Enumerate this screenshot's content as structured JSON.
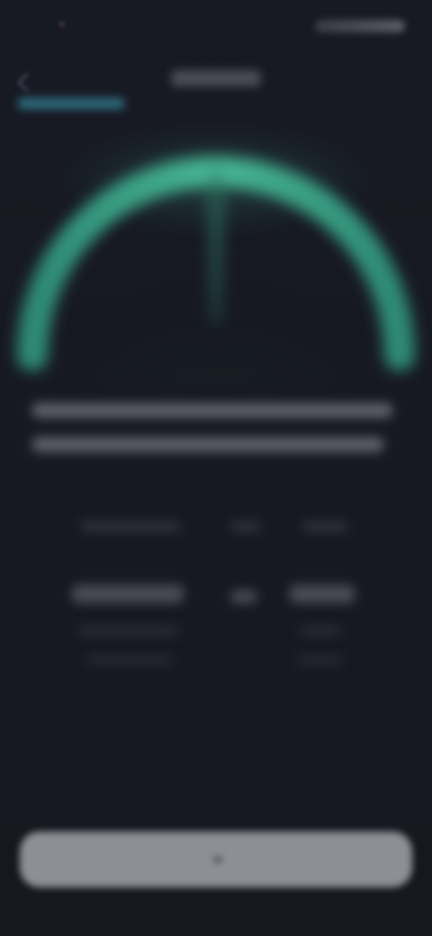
{
  "status_bar": {
    "time": "",
    "icons": [
      "signal-icon",
      "wifi-icon",
      "battery-icon"
    ]
  },
  "nav": {
    "title": "",
    "link": ""
  },
  "gauge": {
    "level": 1.0,
    "accent_color": "#3da88c",
    "track_color": "#1e2a2c"
  },
  "description": {
    "line1": "",
    "line2": ""
  },
  "stats": {
    "left": {
      "label": "",
      "value": "",
      "sub1": "",
      "sub2": ""
    },
    "middle": {
      "label": "",
      "value": ""
    },
    "right": {
      "label": "",
      "value": "",
      "sub1": "",
      "sub2": ""
    }
  },
  "primary_button": {
    "label": ""
  },
  "colors": {
    "background": "#171922",
    "accent": "#3da88c",
    "link": "#2f6e82",
    "button": "#8e8f95"
  }
}
